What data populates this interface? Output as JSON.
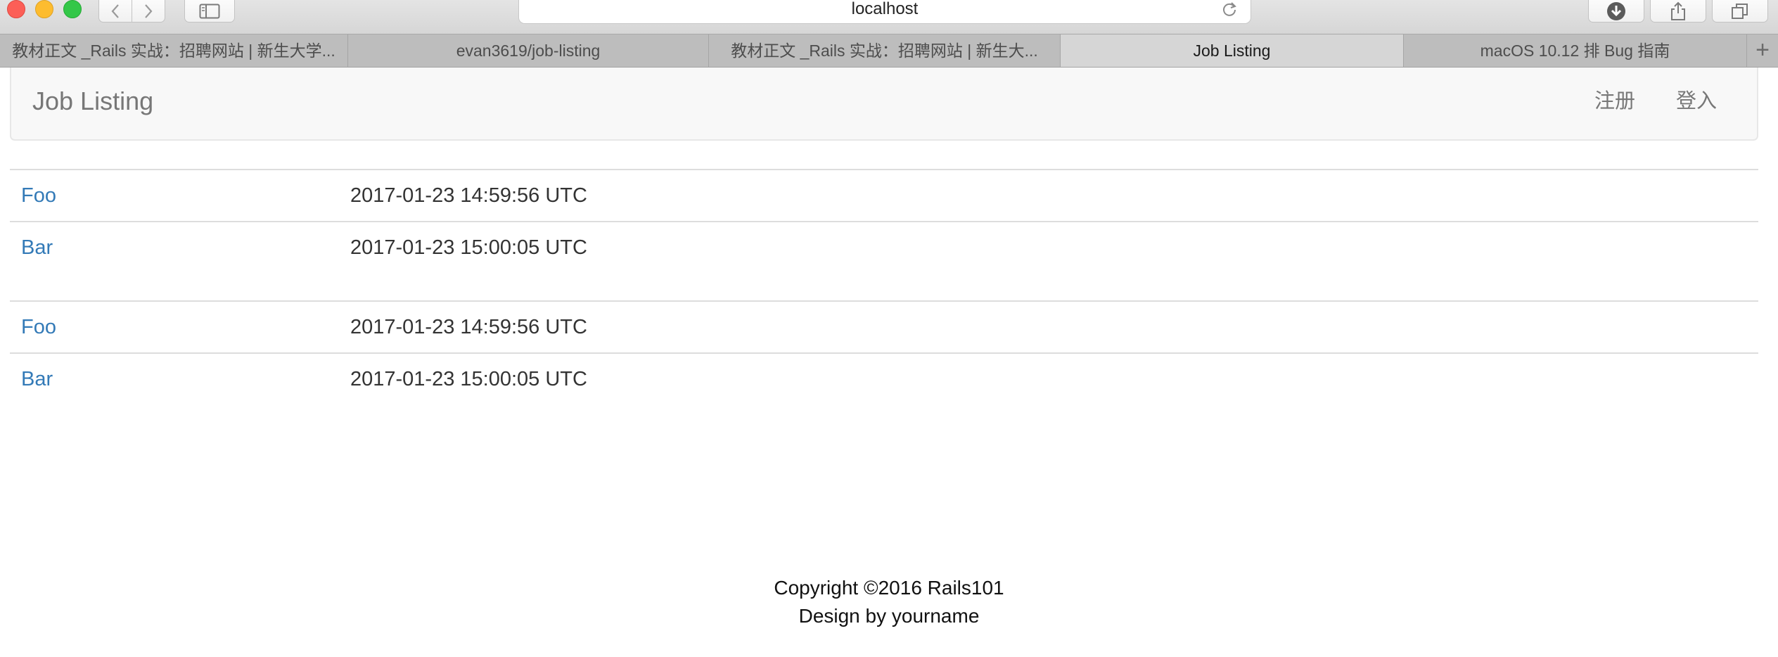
{
  "browser": {
    "address": "localhost",
    "tabs": [
      {
        "label": "教材正文 _Rails 实战：招聘网站 | 新生大学..."
      },
      {
        "label": "evan3619/job-listing"
      },
      {
        "label": "教材正文 _Rails 实战：招聘网站 | 新生大..."
      },
      {
        "label": "Job Listing",
        "active": true
      },
      {
        "label": "macOS 10.12 排 Bug 指南"
      }
    ],
    "new_tab": "+"
  },
  "navbar": {
    "brand": "Job Listing",
    "signup": "注册",
    "login": "登入"
  },
  "tables": [
    {
      "rows": [
        {
          "title": "Foo",
          "created_at": "2017-01-23 14:59:56 UTC"
        },
        {
          "title": "Bar",
          "created_at": "2017-01-23 15:00:05 UTC"
        }
      ]
    },
    {
      "rows": [
        {
          "title": "Foo",
          "created_at": "2017-01-23 14:59:56 UTC"
        },
        {
          "title": "Bar",
          "created_at": "2017-01-23 15:00:05 UTC"
        }
      ]
    }
  ],
  "footer": {
    "copyright": "Copyright ©2016 Rails101",
    "design": "Design by yourname"
  },
  "colors": {
    "link": "#337ab7",
    "navbar_bg": "#f8f8f8",
    "navbar_text": "#777777",
    "active_tab": "#d6d6d6"
  }
}
